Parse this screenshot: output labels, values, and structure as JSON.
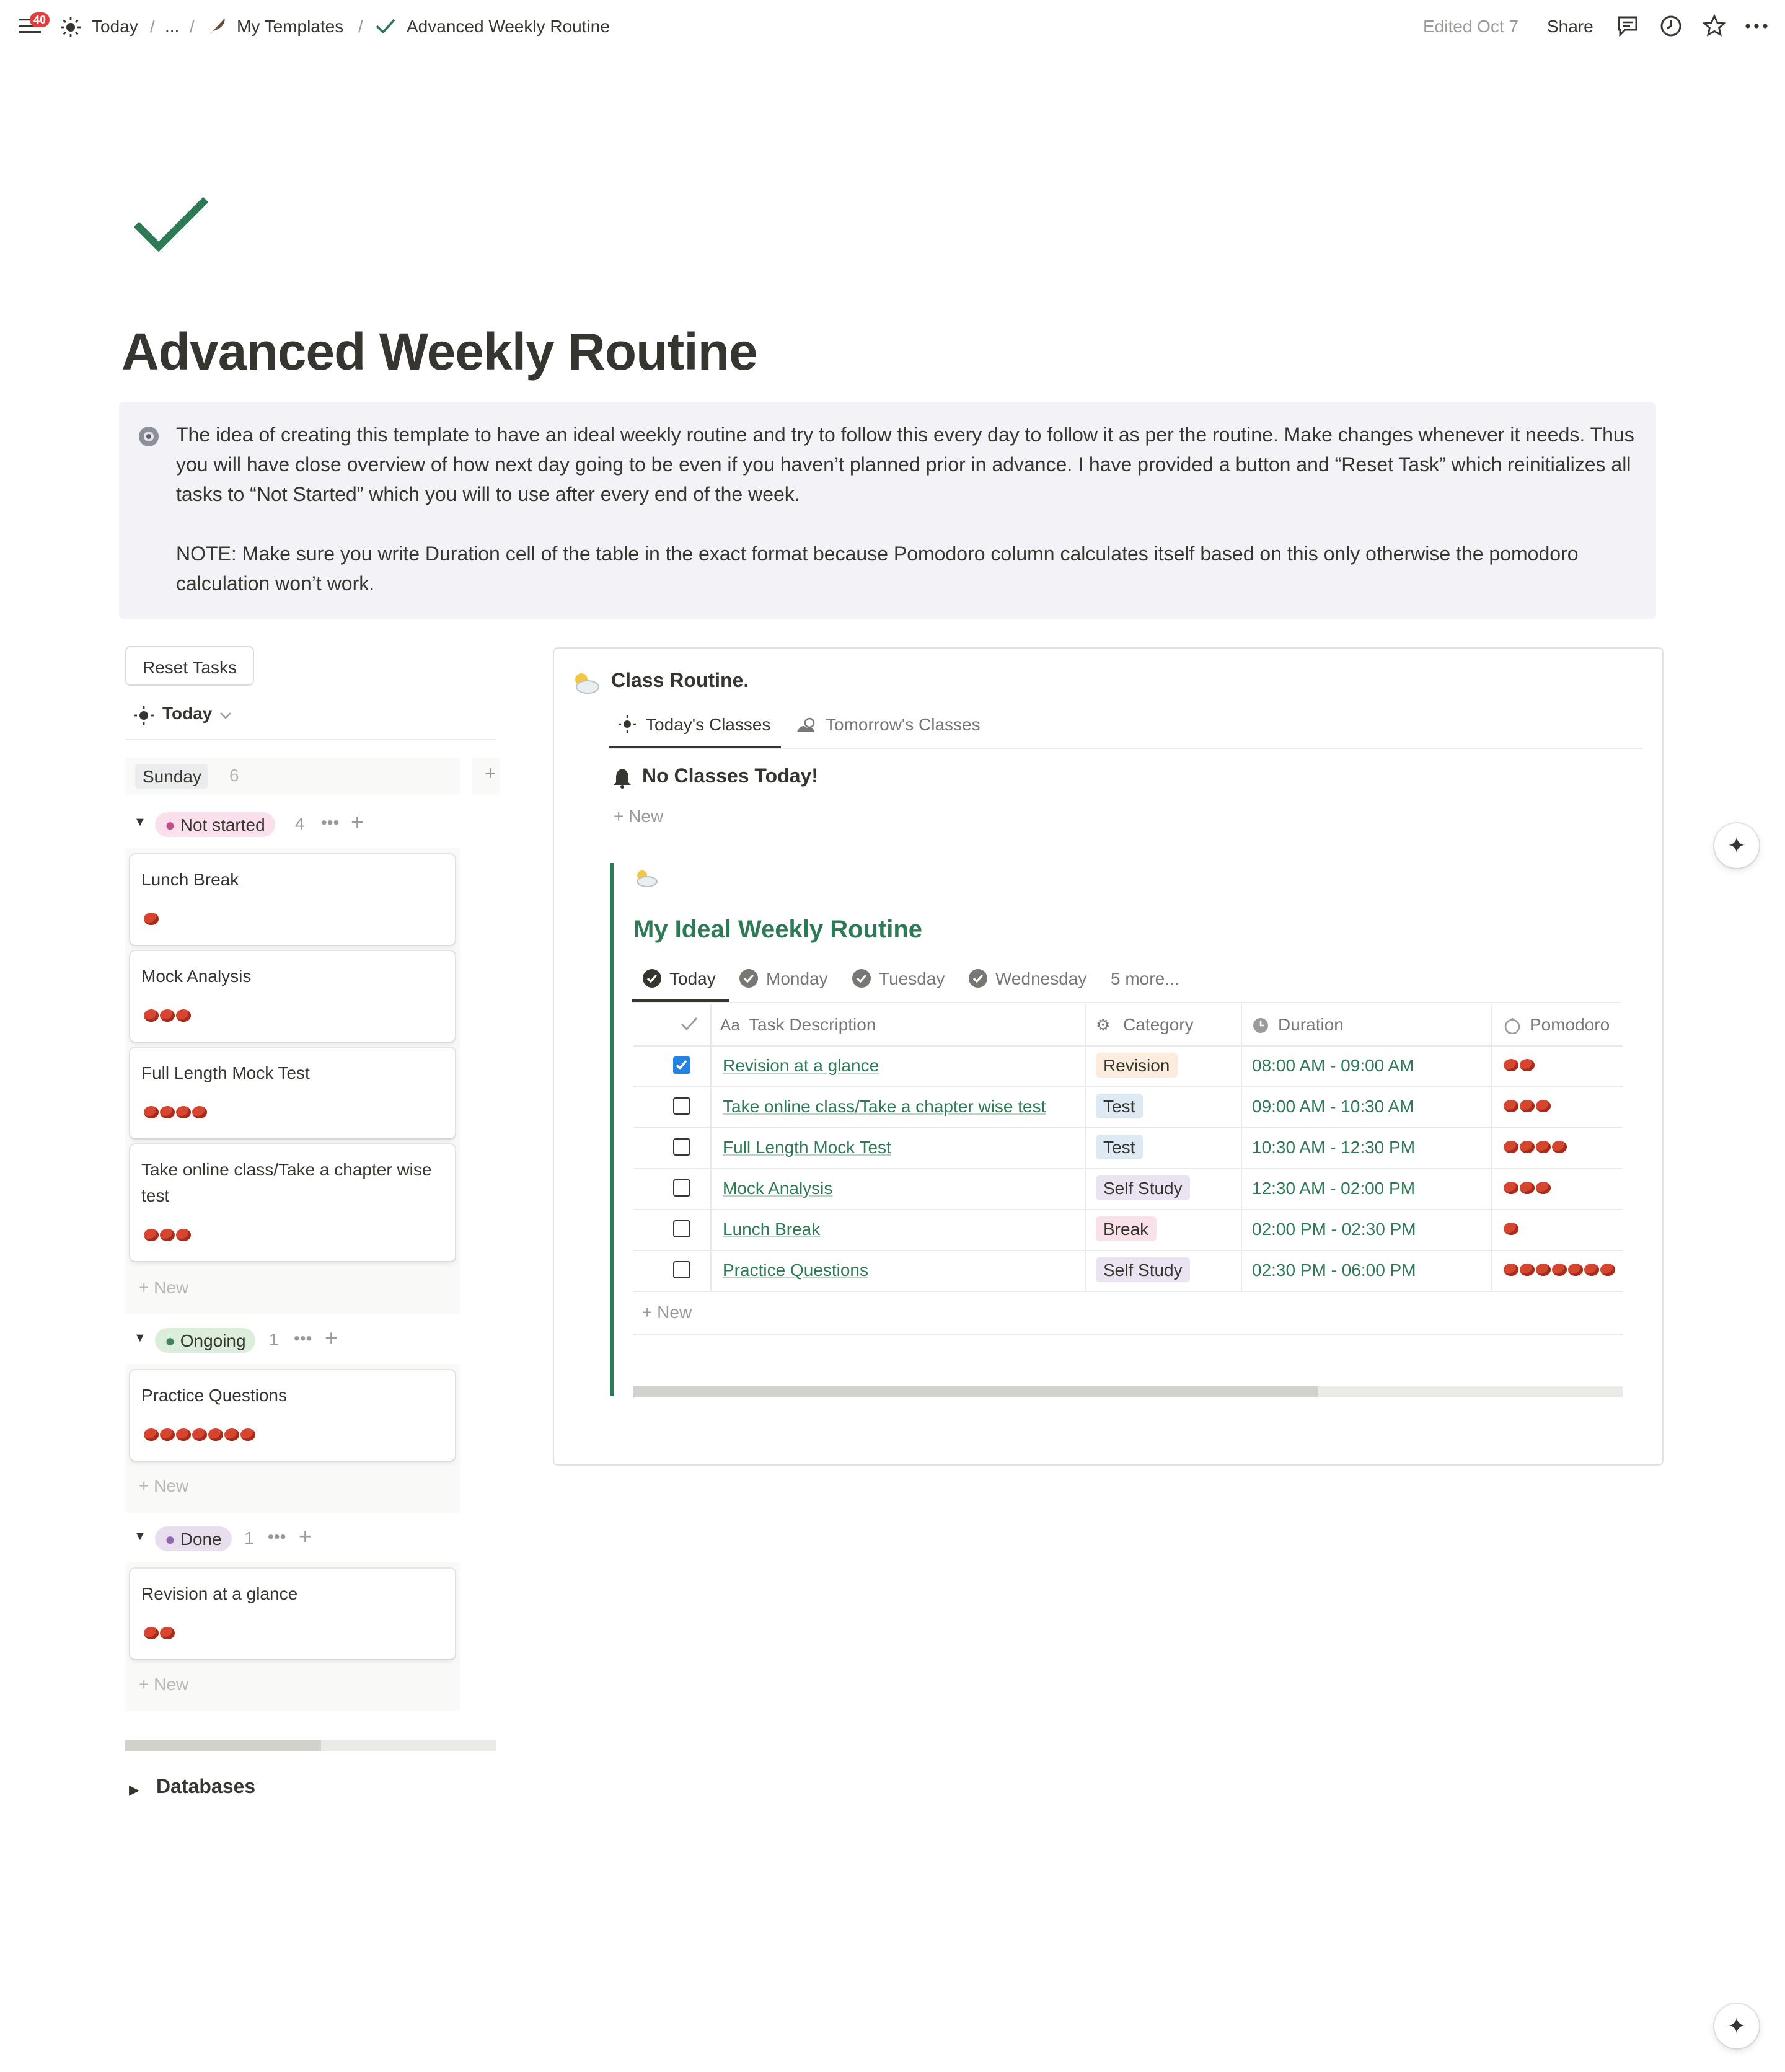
{
  "topbar": {
    "notification_count": "40",
    "crumb_today": "Today",
    "crumb_ellipsis": "...",
    "crumb_templates": "My Templates",
    "crumb_page": "Advanced Weekly Routine",
    "edited": "Edited Oct 7",
    "share": "Share"
  },
  "page": {
    "title": "Advanced Weekly Routine",
    "callout_p1": "The idea of creating this template to have an ideal weekly routine and try to follow this every day to follow it as per the routine. Make changes whenever it needs. Thus you will have close overview of how next day going to be even if you haven’t planned prior in advance. I have provided a button and “Reset Task” which reinitializes all tasks to “Not Started”  which you will to use after every end of the week.",
    "callout_p2": "NOTE: Make sure you write Duration cell of the table in the exact format because Pomodoro column calculates itself based on this only otherwise the pomodoro calculation won’t work."
  },
  "board": {
    "reset_button": "Reset Tasks",
    "view_label": "Today",
    "day_label": "Sunday",
    "day_count": "6",
    "new_label": "New",
    "groups": [
      {
        "status": "Not started",
        "count": "4",
        "color": "#c14c8a",
        "bg": "#f9e0ec",
        "cards": [
          {
            "title": "Lunch Break",
            "pomodoros": 1
          },
          {
            "title": "Mock Analysis",
            "pomodoros": 3
          },
          {
            "title": "Full Length Mock Test",
            "pomodoros": 4
          },
          {
            "title": "Take online class/Take a chapter wise test",
            "pomodoros": 3
          }
        ]
      },
      {
        "status": "Ongoing",
        "count": "1",
        "color": "#448361",
        "bg": "#dbeddb",
        "cards": [
          {
            "title": "Practice Questions",
            "pomodoros": 7
          }
        ]
      },
      {
        "status": "Done",
        "count": "1",
        "color": "#9065b0",
        "bg": "#e8deee",
        "cards": [
          {
            "title": "Revision at a glance",
            "pomodoros": 2
          }
        ]
      }
    ],
    "databases_label": "Databases"
  },
  "classes": {
    "title": "Class Routine.",
    "tab_today": "Today's Classes",
    "tab_tomorrow": "Tomorrow's Classes",
    "empty_message": "No Classes Today!",
    "new_label": "New"
  },
  "routine": {
    "title": "My Ideal Weekly Routine",
    "tabs": [
      "Today",
      "Monday",
      "Tuesday",
      "Wednesday"
    ],
    "more_tabs": "5 more...",
    "columns": {
      "task": "Task Description",
      "category": "Category",
      "duration": "Duration",
      "pomodoro": "Pomodoro"
    },
    "rows": [
      {
        "done": true,
        "task": "Revision at a glance",
        "category": "Revision",
        "cat_bg": "#fbecdd",
        "duration": "08:00 AM - 09:00 AM",
        "pomodoros": 2
      },
      {
        "done": false,
        "task": "Take online class/Take a chapter wise test",
        "category": "Test",
        "cat_bg": "#dde9f3",
        "duration": "09:00 AM - 10:30 AM",
        "pomodoros": 3
      },
      {
        "done": false,
        "task": "Full Length Mock Test",
        "category": "Test",
        "cat_bg": "#dde9f3",
        "duration": "10:30 AM - 12:30 PM",
        "pomodoros": 4
      },
      {
        "done": false,
        "task": "Mock Analysis",
        "category": "Self Study",
        "cat_bg": "#eae4f2",
        "duration": "12:30 AM - 02:00 PM",
        "pomodoros": 3
      },
      {
        "done": false,
        "task": "Lunch Break",
        "category": "Break",
        "cat_bg": "#f9e1e9",
        "duration": "02:00 PM - 02:30 PM",
        "pomodoros": 1
      },
      {
        "done": false,
        "task": "Practice Questions",
        "category": "Self Study",
        "cat_bg": "#eae4f2",
        "duration": "02:30 PM - 06:00 PM",
        "pomodoros": 7
      }
    ],
    "new_label": "New"
  },
  "colors": {
    "accent_green": "#2e7a56",
    "checkbox_blue": "#2383e2",
    "callout_bg": "#f3f2f6"
  }
}
